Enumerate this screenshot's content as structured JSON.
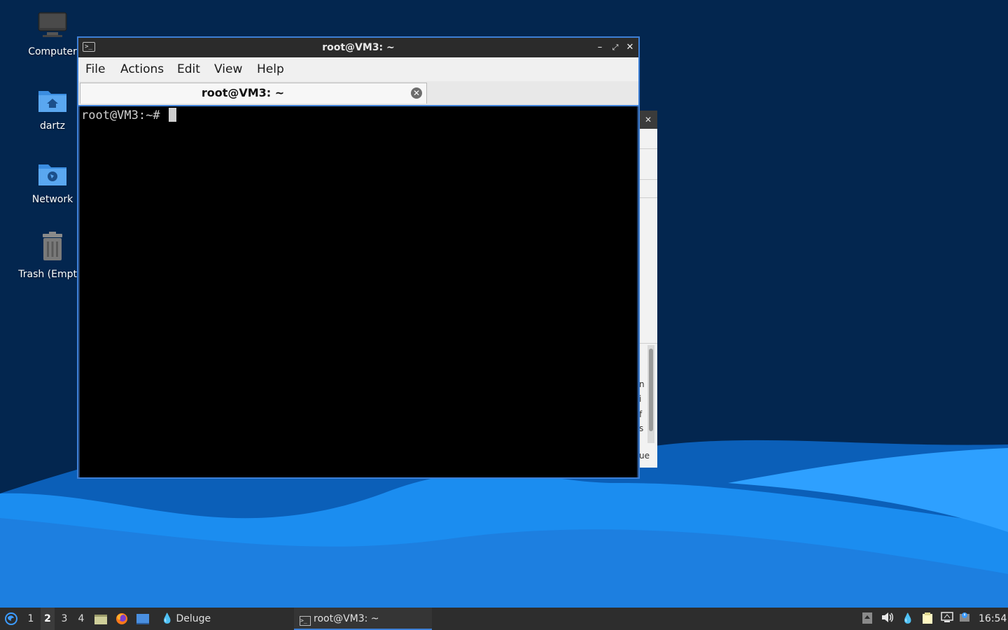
{
  "desktop": {
    "icons": [
      {
        "label": "Computer",
        "icon": "computer-icon"
      },
      {
        "label": "dartz",
        "icon": "home-folder-icon"
      },
      {
        "label": "Network",
        "icon": "network-folder-icon"
      },
      {
        "label": "Trash (Empty)",
        "icon": "trash-icon"
      }
    ]
  },
  "terminal": {
    "title": "root@VM3: ~",
    "menu": [
      "File",
      "Actions",
      "Edit",
      "View",
      "Help"
    ],
    "tab_label": "root@VM3: ~",
    "prompt": "root@VM3:~#"
  },
  "background_window": {
    "fragments": [
      "n",
      "i",
      "f",
      "s",
      "ue"
    ]
  },
  "taskbar": {
    "workspaces": [
      "1",
      "2",
      "3",
      "4"
    ],
    "active_workspace": "2",
    "launchers": [
      "file-manager-icon",
      "firefox-icon",
      "desktop-icon"
    ],
    "tasks": [
      {
        "label": "Deluge",
        "icon": "deluge-icon"
      },
      {
        "label": "root@VM3: ~",
        "icon": "terminal-icon"
      }
    ],
    "clock": "16:54"
  },
  "colors": {
    "accent": "#3d7fd6",
    "titlebar": "#2b2b2b",
    "terminal_bg": "#000000",
    "desktop_dark": "#03264f",
    "wave_blue": "#0f82e6"
  }
}
